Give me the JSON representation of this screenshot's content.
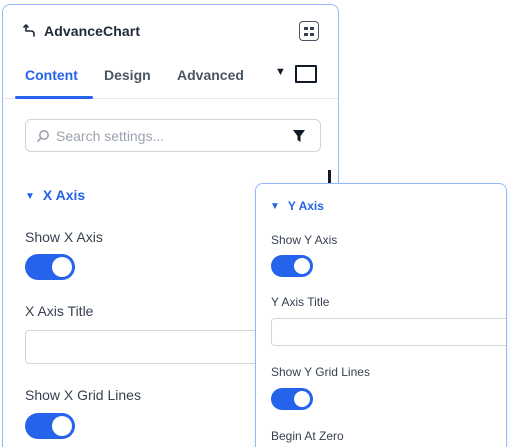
{
  "header": {
    "title": "AdvanceChart"
  },
  "tabs": [
    {
      "label": "Content",
      "active": true
    },
    {
      "label": "Design",
      "active": false
    },
    {
      "label": "Advanced",
      "active": false
    }
  ],
  "search": {
    "placeholder": "Search settings...",
    "value": ""
  },
  "x_axis": {
    "section_label": "X Axis",
    "show_axis_label": "Show X Axis",
    "show_axis_on": true,
    "title_label": "X Axis Title",
    "title_value": "",
    "show_grid_label": "Show X Grid Lines",
    "show_grid_on": true
  },
  "y_axis": {
    "section_label": "Y Axis",
    "show_axis_label": "Show Y Axis",
    "show_axis_on": true,
    "title_label": "Y Axis Title",
    "title_value": "",
    "show_grid_label": "Show Y Grid Lines",
    "show_grid_on": true,
    "begin_zero_label": "Begin At Zero"
  },
  "colors": {
    "accent": "#2563eb",
    "panel_border": "#93b8ff",
    "text": "#1f2937"
  },
  "icons": {
    "back": "back-arrow-icon",
    "layout": "layout-grid-icon",
    "device": "desktop-icon",
    "dropdown": "caret-down-icon",
    "search": "search-icon",
    "filter": "filter-icon"
  }
}
